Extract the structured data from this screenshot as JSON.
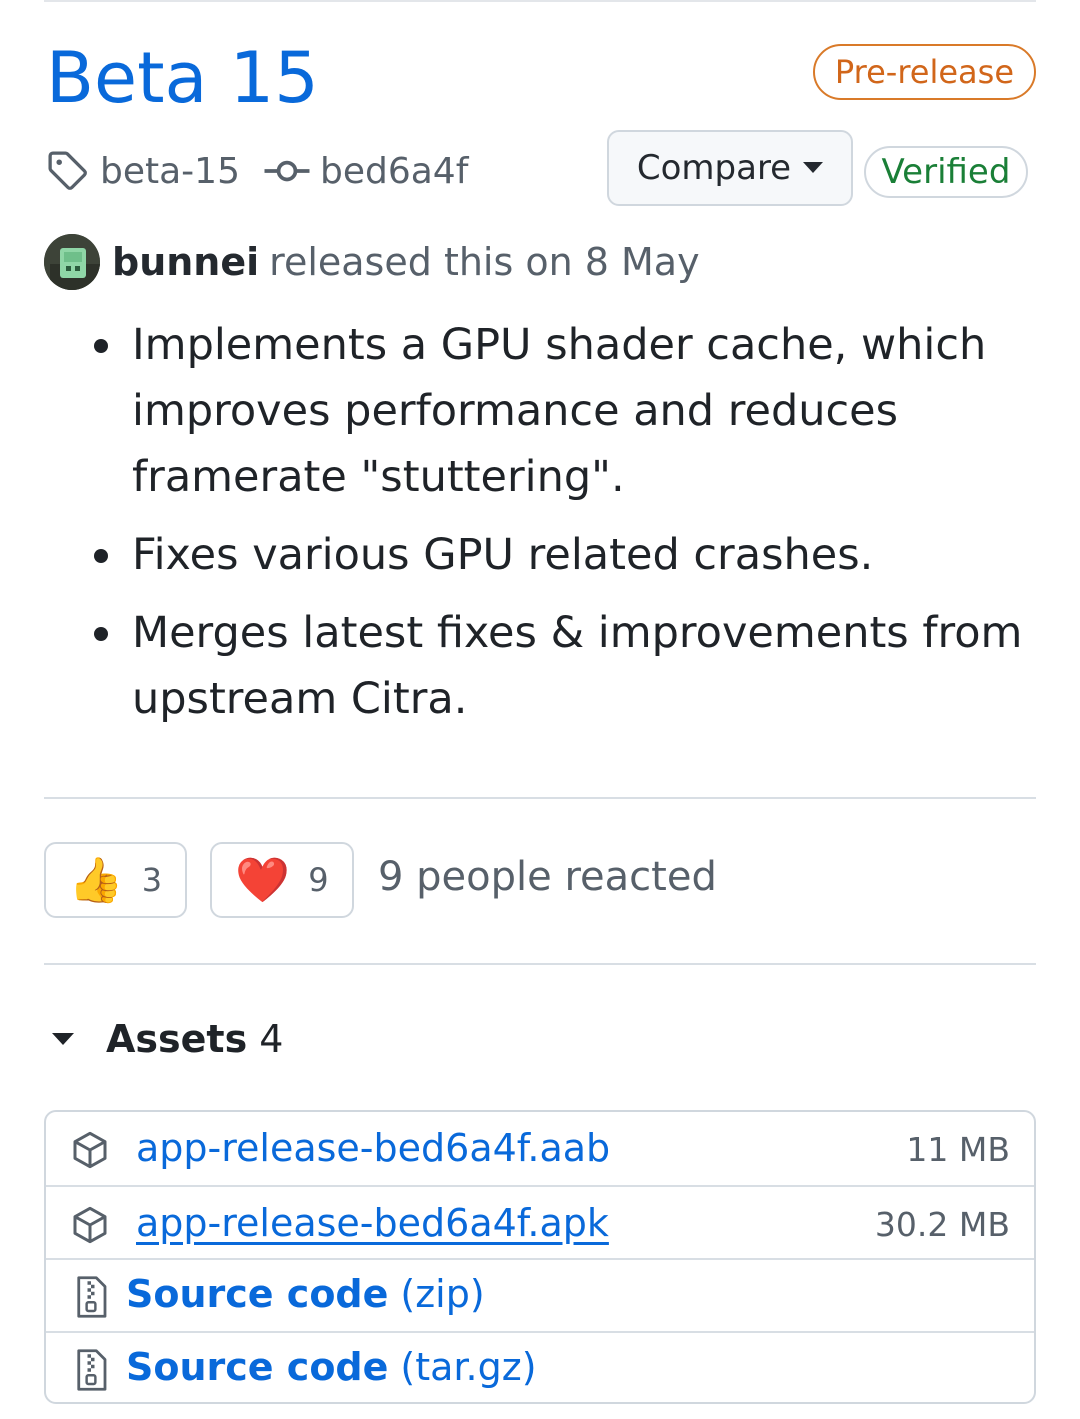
{
  "release": {
    "title": "Beta 15",
    "prerelease_badge": "Pre-release",
    "tag": "beta-15",
    "commit": "bed6a4f",
    "compare_label": "Compare",
    "verified_label": "Verified",
    "author": "bunnei",
    "released_text": "released this on 8 May",
    "notes": [
      "Implements a GPU shader cache, which improves performance and reduces framerate \"stuttering\".",
      "Fixes various GPU related crashes.",
      "Merges latest fixes & improvements from upstream Citra."
    ]
  },
  "reactions": {
    "thumbs_up": {
      "emoji": "👍",
      "count": "3"
    },
    "heart": {
      "emoji": "❤️",
      "count": "9"
    },
    "summary": "9 people reacted"
  },
  "assets": {
    "title": "Assets",
    "count": "4",
    "files": [
      {
        "name": "app-release-bed6a4f.aab",
        "size": "11 MB"
      },
      {
        "name": "app-release-bed6a4f.apk",
        "size": "30.2 MB"
      }
    ],
    "source": [
      {
        "name": "Source code",
        "ext": "(zip)"
      },
      {
        "name": "Source code",
        "ext": "(tar.gz)"
      }
    ]
  },
  "colors": {
    "link": "#0969da",
    "prerelease": "#d1661a",
    "verified": "#1a7f37",
    "muted": "#57606a"
  },
  "icons": {
    "tag": "tag-icon",
    "commit": "git-commit-icon",
    "caret": "triangle-down-icon",
    "package": "package-icon",
    "zip": "file-zip-icon"
  }
}
